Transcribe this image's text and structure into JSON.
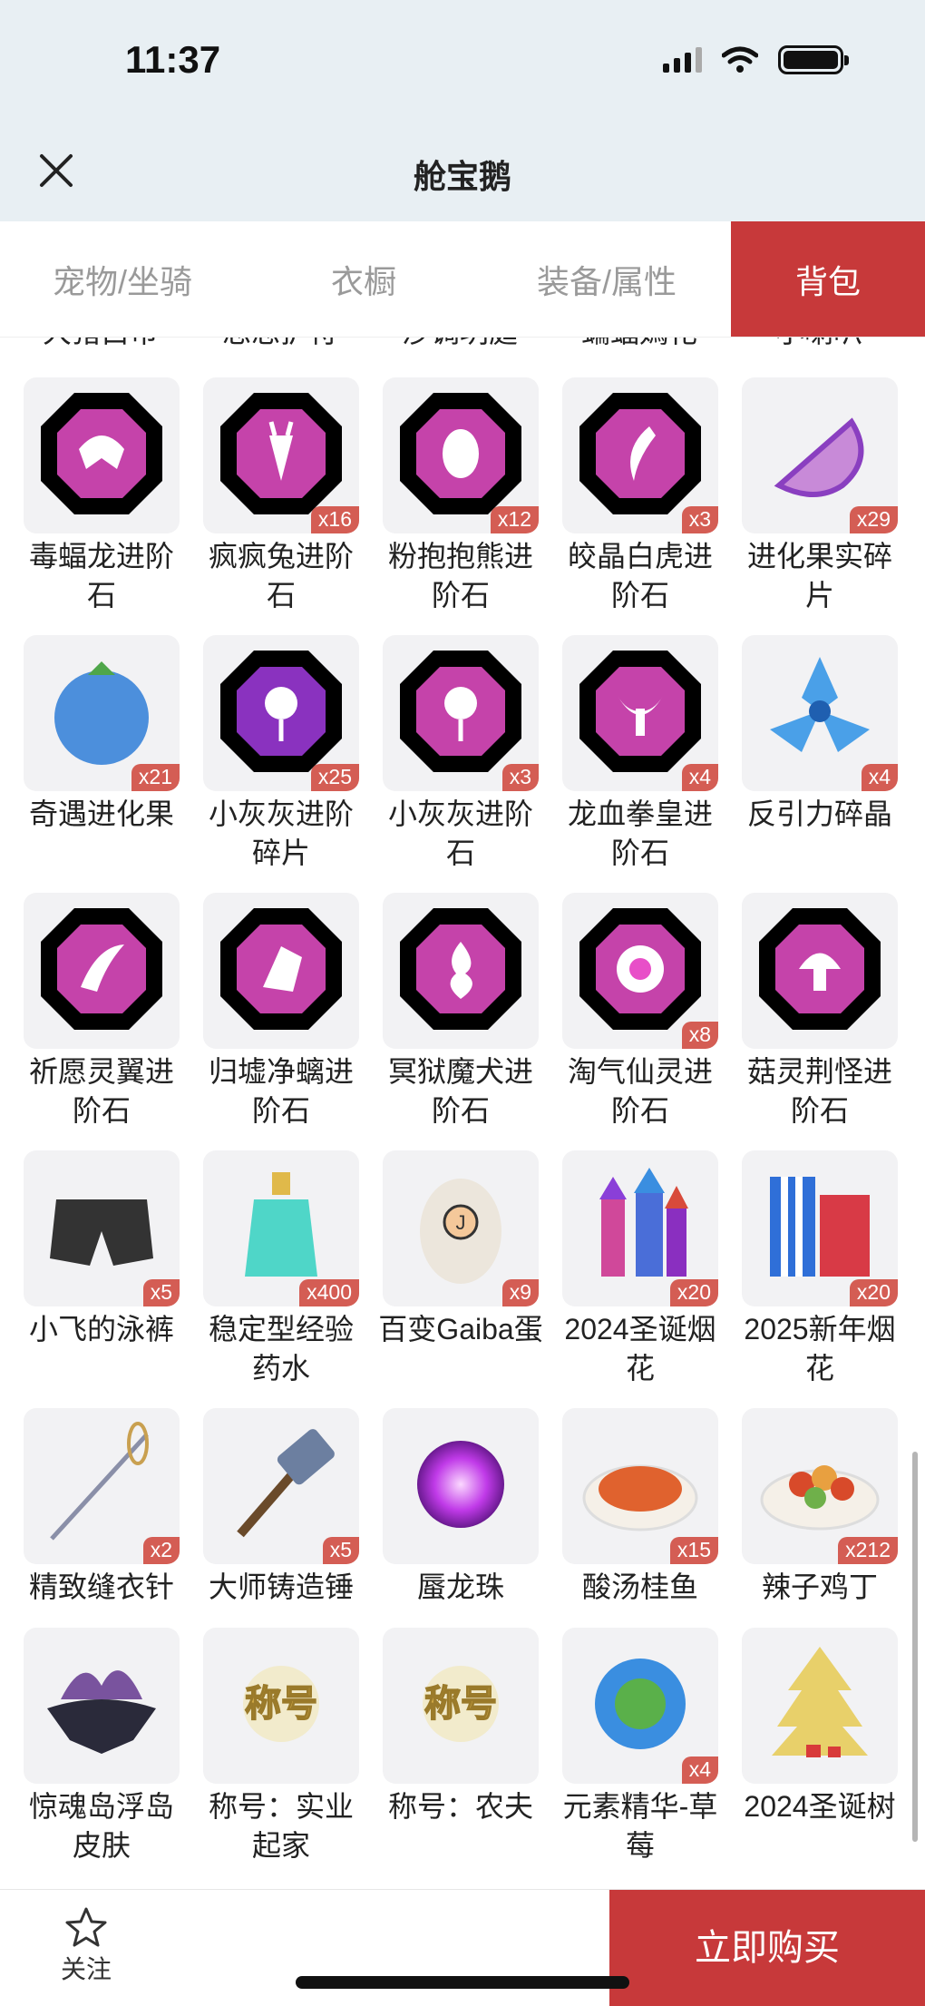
{
  "status": {
    "time": "11:37"
  },
  "header": {
    "title": "舱宝鹅"
  },
  "tabs": [
    "宠物/坐骑",
    "衣橱",
    "装备/属性",
    "背包"
  ],
  "cut_labels": [
    "大猪白币",
    "思思护符",
    "沙调玥庭",
    "蝙蝠嫣花",
    "小喇叭"
  ],
  "items": [
    {
      "name": "毒蝠龙进阶石",
      "count": "",
      "icon": "gem-bat-icon",
      "color": "#e84fc8"
    },
    {
      "name": "疯疯兔进阶石",
      "count": "x16",
      "icon": "gem-carrot-icon",
      "color": "#e84fc8"
    },
    {
      "name": "粉抱抱熊进阶石",
      "count": "x12",
      "icon": "gem-egg-icon",
      "color": "#e84fc8"
    },
    {
      "name": "皎晶白虎进阶石",
      "count": "x3",
      "icon": "gem-claw-icon",
      "color": "#e84fc8"
    },
    {
      "name": "进化果实碎片",
      "count": "x29",
      "icon": "fruit-slice-icon",
      "color": "#c88ad8"
    },
    {
      "name": "奇遇进化果",
      "count": "x21",
      "icon": "blue-fruit-icon",
      "color": "#4c8fdc"
    },
    {
      "name": "小灰灰进阶碎片",
      "count": "x25",
      "icon": "gem-lollipop-icon",
      "color": "#a23be0"
    },
    {
      "name": "小灰灰进阶石",
      "count": "x3",
      "icon": "gem-lollipop-icon",
      "color": "#e84fc8"
    },
    {
      "name": "龙血拳皇进阶石",
      "count": "x4",
      "icon": "gem-bull-icon",
      "color": "#e84fc8"
    },
    {
      "name": "反引力碎晶",
      "count": "x4",
      "icon": "crystal-shard-icon",
      "color": "#4aa0e8"
    },
    {
      "name": "祈愿灵翼进阶石",
      "count": "",
      "icon": "gem-wing-icon",
      "color": "#e84fc8"
    },
    {
      "name": "归墟净螭进阶石",
      "count": "",
      "icon": "gem-scale-icon",
      "color": "#e84fc8"
    },
    {
      "name": "冥狱魔犬进阶石",
      "count": "",
      "icon": "gem-flame-icon",
      "color": "#e84fc8"
    },
    {
      "name": "淘气仙灵进阶石",
      "count": "x8",
      "icon": "gem-fairy-icon",
      "color": "#e84fc8"
    },
    {
      "name": "菇灵荆怪进阶石",
      "count": "",
      "icon": "gem-mushroom-icon",
      "color": "#e84fc8"
    },
    {
      "name": "小飞的泳裤",
      "count": "x5",
      "icon": "swim-shorts-icon",
      "color": "#333333"
    },
    {
      "name": "稳定型经验药水",
      "count": "x400",
      "icon": "potion-bottle-icon",
      "color": "#4fd6c8"
    },
    {
      "name": "百变Gaiba蛋",
      "count": "x9",
      "icon": "egg-icon",
      "color": "#ece6dc"
    },
    {
      "name": "2024圣诞烟花",
      "count": "x20",
      "icon": "firework-rockets-icon",
      "color": "#d0489a"
    },
    {
      "name": "2025新年烟花",
      "count": "x20",
      "icon": "firework-tubes-icon",
      "color": "#d83a46"
    },
    {
      "name": "精致缝衣针",
      "count": "x2",
      "icon": "needle-icon",
      "color": "#8a8fa8"
    },
    {
      "name": "大师铸造锤",
      "count": "x5",
      "icon": "hammer-icon",
      "color": "#6c7fa0"
    },
    {
      "name": "蜃龙珠",
      "count": "",
      "icon": "purple-orb-icon",
      "color": "#c03ae8"
    },
    {
      "name": "酸汤桂鱼",
      "count": "x15",
      "icon": "fish-dish-icon",
      "color": "#e0622e"
    },
    {
      "name": "辣子鸡丁",
      "count": "x212",
      "icon": "chicken-dish-icon",
      "color": "#d84a2a"
    },
    {
      "name": "惊魂岛浮岛皮肤",
      "count": "",
      "icon": "floating-island-icon",
      "color": "#5a2a88"
    },
    {
      "name": "称号：实业起家",
      "count": "",
      "icon": "title-badge-icon",
      "color": "#d8b04a"
    },
    {
      "name": "称号：农夫",
      "count": "",
      "icon": "title-badge-icon",
      "color": "#d8b04a"
    },
    {
      "name": "元素精华-草莓",
      "count": "x4",
      "icon": "element-orb-icon",
      "color": "#3a8ee0"
    },
    {
      "name": "2024圣诞树",
      "count": "",
      "icon": "christmas-tree-icon",
      "color": "#e8d06a"
    }
  ],
  "title_badge_text": "称号",
  "egg_letter": "J",
  "bottom": {
    "follow_label": "关注",
    "buy_label": "立即购买"
  }
}
